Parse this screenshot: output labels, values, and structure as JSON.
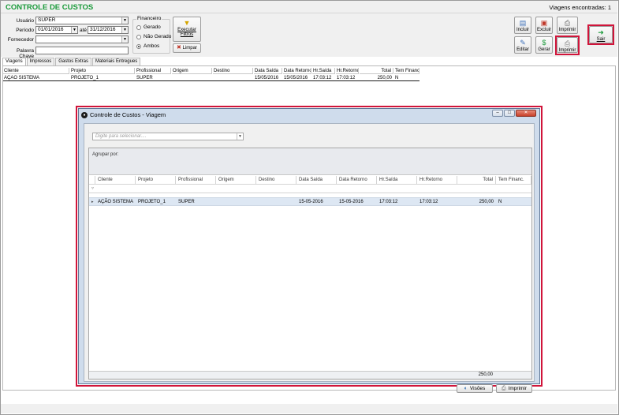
{
  "app": {
    "title": "CONTROLE DE CUSTOS",
    "trips_found": "Viagens encontradas: 1"
  },
  "filters": {
    "user_label": "Usuário",
    "user_value": "SUPER",
    "period_label": "Período",
    "period_from": "01/01/2016",
    "period_to_label": "até",
    "period_to": "31/12/2016",
    "supplier_label": "Fornecedor",
    "supplier_value": "",
    "keyword_label": "Palavra Chave",
    "keyword_value": "",
    "financial_group_label": "Financeiro",
    "radio_options": [
      "Gerado",
      "Não Gerado",
      "Ambos"
    ],
    "radio_selected": "Ambos",
    "run_filters_label": "Executar Filtros",
    "clear_label": "Limpar"
  },
  "toolbar": {
    "include_label": "Incluir",
    "delete_label": "Excluir",
    "print_label": "Imprimir",
    "edit_label": "Editar",
    "generate_label": "Gerar",
    "print2_label": "Imprimir",
    "exit_label": "Sair"
  },
  "tabs": [
    "Viagens",
    "Impressos",
    "Gastos Extras",
    "Materiais Entregues"
  ],
  "grid": {
    "columns": [
      "Cliente",
      "Projeto",
      "Profissional",
      "Origem",
      "Destino",
      "Data Saída",
      "Data Retorno",
      "Hr.Saída",
      "Hr.Retorno",
      "Total",
      "Tem Financ."
    ],
    "rows": [
      [
        "AÇÃO SISTEMA",
        "PROJETO_1",
        "SUPER",
        "",
        "",
        "15/05/2016",
        "15/05/2016",
        "17:03:12",
        "17:03:12",
        "250,00",
        "N"
      ]
    ]
  },
  "dialog": {
    "title": "Controle de Custos - Viagem",
    "lookup_placeholder": "Digite para selecionar....",
    "group_by_label": "Agrupar por:",
    "columns": [
      "Cliente",
      "Projeto",
      "Profissional",
      "Origem",
      "Destino",
      "Data Saída",
      "Data Retorno",
      "Hr.Saída",
      "Hr.Retorno",
      "Total",
      "Tem Financ."
    ],
    "rows": [
      [
        "AÇÃO SISTEMA",
        "PROJETO_1",
        "SUPER",
        "",
        "",
        "15-05-2016",
        "15-05-2016",
        "17:03:12",
        "17:03:12",
        "250,00",
        "N"
      ]
    ],
    "footer_total": "250,00",
    "views_label": "Visões",
    "print_label": "Imprimir"
  },
  "colors": {
    "title_green": "#1a9a3a",
    "highlight_red": "#d0143a",
    "selected_row": "#dde7f3"
  }
}
